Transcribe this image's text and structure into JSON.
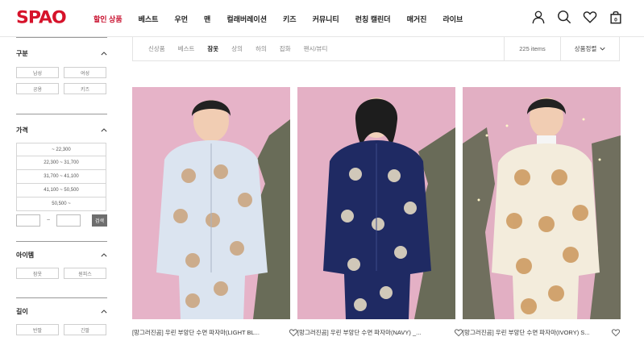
{
  "brand": {
    "logo": "SPAO",
    "color": "#d6122a"
  },
  "nav": [
    {
      "label": "할인 상품",
      "highlight": true
    },
    {
      "label": "베스트"
    },
    {
      "label": "우먼"
    },
    {
      "label": "맨"
    },
    {
      "label": "컬래버레이션"
    },
    {
      "label": "키즈"
    },
    {
      "label": "커뮤니티"
    },
    {
      "label": "런칭 캘린더"
    },
    {
      "label": "매거진"
    },
    {
      "label": "라이브"
    }
  ],
  "header_icons": [
    "user-icon",
    "search-icon",
    "heart-icon",
    "cart-icon"
  ],
  "cart": {
    "count": "0"
  },
  "filters": {
    "category": {
      "title": "구분",
      "options": [
        "남성",
        "여성",
        "공용",
        "키즈"
      ]
    },
    "price": {
      "title": "가격",
      "options": [
        "~ 22,300",
        "22,300 ~ 31,700",
        "31,700 ~ 41,100",
        "41,100 ~ 50,500",
        "50,500 ~"
      ],
      "range_separator": "~",
      "search_label": "검색"
    },
    "item": {
      "title": "아이템",
      "options": [
        "잠옷",
        "원피스"
      ]
    },
    "length": {
      "title": "길이",
      "options": [
        "반팔",
        "긴팔"
      ]
    }
  },
  "category_tabs": [
    {
      "label": "신상품"
    },
    {
      "label": "베스트"
    },
    {
      "label": "잠옷",
      "active": true
    },
    {
      "label": "상의"
    },
    {
      "label": "하의"
    },
    {
      "label": "잡화"
    },
    {
      "label": "팬시/뷰티"
    }
  ],
  "items_count": "225 items",
  "sort_label": "상품정렬",
  "products": [
    {
      "name": "[망그러진곰] 우린 부앙단 수면 파자마(LIGHT BL...",
      "bg": "#e7b2c7",
      "pajama": "#dbe4f0",
      "pattern": "#c89a6b"
    },
    {
      "name": "[망그러진곰] 우린 부앙단 수면 파자마(NAVY) _...",
      "bg": "#e4b0c5",
      "pajama": "#1f2a63",
      "pattern": "#f0e4c8"
    },
    {
      "name": "[망그러진곰] 우린 부앙단 수면 파자마(IVORY) S...",
      "bg": "#e2afc3",
      "pajama": "#f3ecdc",
      "pattern": "#c99253"
    }
  ]
}
